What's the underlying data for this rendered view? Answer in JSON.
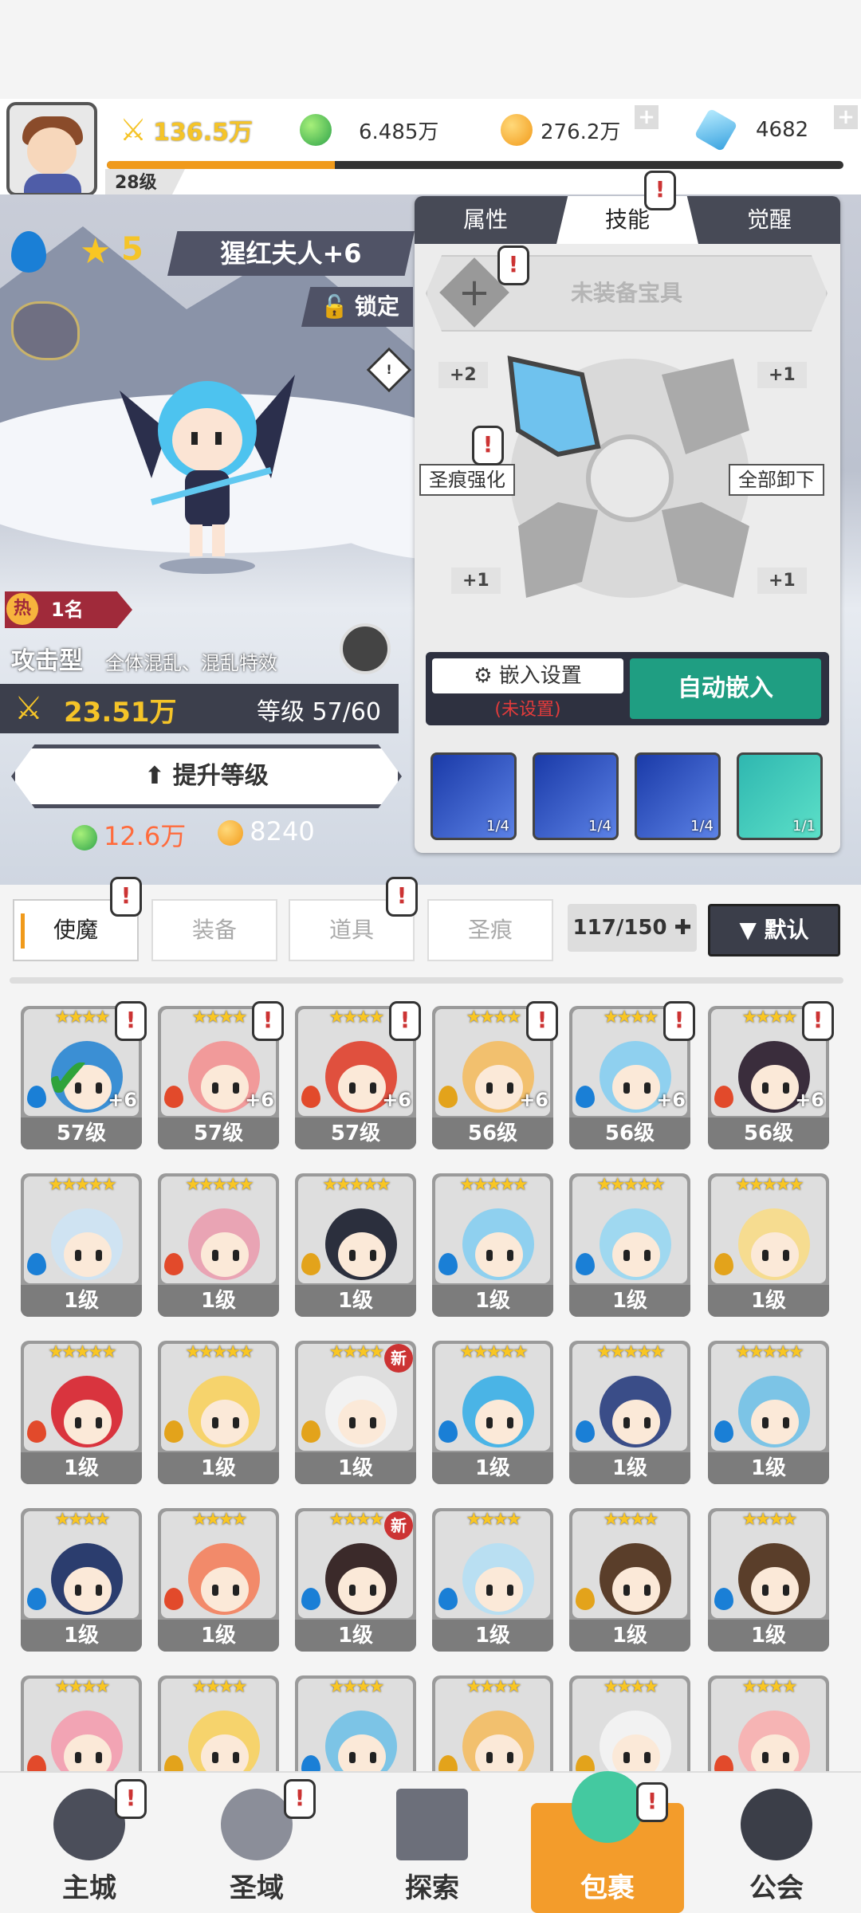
{
  "player": {
    "level": "28级",
    "exp_progress": 0.31
  },
  "resources": {
    "power": "136.5万",
    "green_gem": "6.485万",
    "gold": "276.2万",
    "crystal": "4682"
  },
  "hero": {
    "stars": "5",
    "name": "猩红夫人+6",
    "lock_label": "锁定",
    "rank_badge": "热",
    "rank": "1名",
    "type": "攻击型",
    "effect": "全体混乱、混乱特效",
    "power": "23.51万",
    "level_label": "等级 57/60",
    "upgrade_label": "提升等级",
    "upgrade_cost_green": "12.6万",
    "upgrade_cost_gold": "8240"
  },
  "panel": {
    "tabs": [
      "属性",
      "技能",
      "觉醒"
    ],
    "active_tab": "技能",
    "gear_slot": "未装备宝具",
    "mods": [
      "+2",
      "+1",
      "+1",
      "+1"
    ],
    "enhance_button": "圣痕强化",
    "unequip_button": "全部卸下",
    "embed_settings": "嵌入设置",
    "embed_status": "(未设置)",
    "auto_embed": "自动嵌入",
    "skills": [
      {
        "count": "1/4"
      },
      {
        "count": "1/4"
      },
      {
        "count": "1/4"
      },
      {
        "count": "1/1"
      }
    ]
  },
  "tabs": [
    "使魔",
    "装备",
    "道具",
    "圣痕"
  ],
  "inventory": {
    "count": "117/150",
    "sort": "默认"
  },
  "cards": [
    {
      "stars": "★★★★",
      "level": "57级",
      "plus": "+6",
      "element": "water",
      "color": "#3b8fd4",
      "warn": true,
      "check": true
    },
    {
      "stars": "★★★★",
      "level": "57级",
      "plus": "+6",
      "element": "fire",
      "color": "#f19a9a",
      "warn": true
    },
    {
      "stars": "★★★★",
      "level": "57级",
      "plus": "+6",
      "element": "fire",
      "color": "#e0503e",
      "warn": true
    },
    {
      "stars": "★★★★",
      "level": "56级",
      "plus": "+6",
      "element": "wind",
      "color": "#f2c06e",
      "warn": true
    },
    {
      "stars": "★★★★",
      "level": "56级",
      "plus": "+6",
      "element": "water",
      "color": "#8fd0ef",
      "warn": true
    },
    {
      "stars": "★★★★",
      "level": "56级",
      "plus": "+6",
      "element": "fire",
      "color": "#3a2d3c",
      "warn": true
    },
    {
      "stars": "★★★★★",
      "level": "1级",
      "element": "water",
      "color": "#cfe3f2"
    },
    {
      "stars": "★★★★★",
      "level": "1级",
      "element": "fire",
      "color": "#e9a4b4"
    },
    {
      "stars": "★★★★★",
      "level": "1级",
      "element": "wind",
      "color": "#2b2f3d"
    },
    {
      "stars": "★★★★★",
      "level": "1级",
      "element": "water",
      "color": "#8fd0ef"
    },
    {
      "stars": "★★★★★",
      "level": "1级",
      "element": "water",
      "color": "#9fd8f0"
    },
    {
      "stars": "★★★★★",
      "level": "1级",
      "element": "wind",
      "color": "#f6dc90"
    },
    {
      "stars": "★★★★★",
      "level": "1级",
      "element": "fire",
      "color": "#d9343e"
    },
    {
      "stars": "★★★★★",
      "level": "1级",
      "element": "wind",
      "color": "#f6d36c"
    },
    {
      "stars": "★★★★",
      "level": "1级",
      "element": "wind",
      "color": "#f2f2f2",
      "new": "新"
    },
    {
      "stars": "★★★★★",
      "level": "1级",
      "element": "water",
      "color": "#4ab4e6"
    },
    {
      "stars": "★★★★★",
      "level": "1级",
      "element": "water",
      "color": "#3a4d88"
    },
    {
      "stars": "★★★★★",
      "level": "1级",
      "element": "water",
      "color": "#7cc4e6"
    },
    {
      "stars": "★★★★",
      "level": "1级",
      "element": "water",
      "color": "#2b3d6e"
    },
    {
      "stars": "★★★★",
      "level": "1级",
      "element": "fire",
      "color": "#f28a6a"
    },
    {
      "stars": "★★★★",
      "level": "1级",
      "element": "water",
      "color": "#3b2a2a",
      "new": "新"
    },
    {
      "stars": "★★★★",
      "level": "1级",
      "element": "water",
      "color": "#b9dff2"
    },
    {
      "stars": "★★★★",
      "level": "1级",
      "element": "wind",
      "color": "#5a3e2a"
    },
    {
      "stars": "★★★★",
      "level": "1级",
      "element": "water",
      "color": "#5a3e2a"
    },
    {
      "stars": "★★★★",
      "element": "fire",
      "color": "#f2a4b4"
    },
    {
      "stars": "★★★★",
      "element": "wind",
      "color": "#f6d36c"
    },
    {
      "stars": "★★★★",
      "element": "water",
      "color": "#7cc4e6"
    },
    {
      "stars": "★★★★",
      "element": "wind",
      "color": "#f2c06e"
    },
    {
      "stars": "★★★★",
      "element": "wind",
      "color": "#f2f2f2"
    },
    {
      "stars": "★★★★",
      "element": "fire",
      "color": "#f6b4b4"
    }
  ],
  "nav": [
    {
      "label": "主城",
      "warn": true
    },
    {
      "label": "圣域",
      "warn": true
    },
    {
      "label": "探索"
    },
    {
      "label": "包裹",
      "warn": true,
      "active": true
    },
    {
      "label": "公会"
    }
  ],
  "colors": {
    "accent": "#f09a1b",
    "teal": "#1f9e82",
    "dark": "#474a56",
    "water": "#1a7fd6",
    "fire": "#e24a2b",
    "wind": "#e3a31b"
  }
}
